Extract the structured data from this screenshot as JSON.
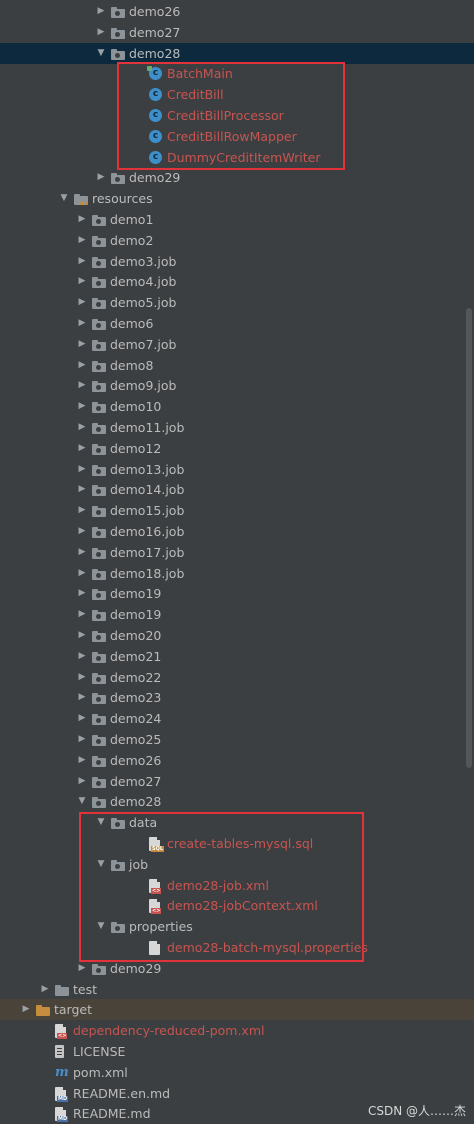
{
  "tree": [
    {
      "label": "demo26",
      "indent": 2,
      "arrow": "right",
      "icon": "folder",
      "style": "normal",
      "icon_name": "folder-icon"
    },
    {
      "label": "demo27",
      "indent": 2,
      "arrow": "right",
      "icon": "folder",
      "style": "normal",
      "icon_name": "folder-icon"
    },
    {
      "label": "demo28",
      "indent": 2,
      "arrow": "down",
      "icon": "folder",
      "style": "normal",
      "selected": true,
      "icon_name": "folder-icon"
    },
    {
      "label": "BatchMain",
      "indent": 3,
      "arrow": "",
      "icon": "class-main",
      "style": "file-mod",
      "icon_name": "class-main-icon"
    },
    {
      "label": "CreditBill",
      "indent": 3,
      "arrow": "",
      "icon": "class",
      "style": "file-mod",
      "icon_name": "class-icon"
    },
    {
      "label": "CreditBillProcessor",
      "indent": 3,
      "arrow": "",
      "icon": "class",
      "style": "file-mod",
      "icon_name": "class-icon"
    },
    {
      "label": "CreditBillRowMapper",
      "indent": 3,
      "arrow": "",
      "icon": "class",
      "style": "file-mod",
      "icon_name": "class-icon"
    },
    {
      "label": "DummyCreditItemWriter",
      "indent": 3,
      "arrow": "",
      "icon": "class",
      "style": "file-mod",
      "icon_name": "class-icon"
    },
    {
      "label": "demo29",
      "indent": 2,
      "arrow": "right",
      "icon": "folder",
      "style": "normal",
      "icon_name": "folder-icon"
    },
    {
      "label": "resources",
      "indent": 1,
      "arrow": "down",
      "icon": "res-folder",
      "style": "normal",
      "icon_name": "resources-folder-icon"
    },
    {
      "label": "demo1",
      "indent": 1.5,
      "arrow": "right",
      "icon": "folder",
      "style": "normal",
      "icon_name": "folder-icon"
    },
    {
      "label": "demo2",
      "indent": 1.5,
      "arrow": "right",
      "icon": "folder",
      "style": "normal",
      "icon_name": "folder-icon"
    },
    {
      "label": "demo3.job",
      "indent": 1.5,
      "arrow": "right",
      "icon": "folder",
      "style": "normal",
      "icon_name": "folder-icon"
    },
    {
      "label": "demo4.job",
      "indent": 1.5,
      "arrow": "right",
      "icon": "folder",
      "style": "normal",
      "icon_name": "folder-icon"
    },
    {
      "label": "demo5.job",
      "indent": 1.5,
      "arrow": "right",
      "icon": "folder",
      "style": "normal",
      "icon_name": "folder-icon"
    },
    {
      "label": "demo6",
      "indent": 1.5,
      "arrow": "right",
      "icon": "folder",
      "style": "normal",
      "icon_name": "folder-icon"
    },
    {
      "label": "demo7.job",
      "indent": 1.5,
      "arrow": "right",
      "icon": "folder",
      "style": "normal",
      "icon_name": "folder-icon"
    },
    {
      "label": "demo8",
      "indent": 1.5,
      "arrow": "right",
      "icon": "folder",
      "style": "normal",
      "icon_name": "folder-icon"
    },
    {
      "label": "demo9.job",
      "indent": 1.5,
      "arrow": "right",
      "icon": "folder",
      "style": "normal",
      "icon_name": "folder-icon"
    },
    {
      "label": "demo10",
      "indent": 1.5,
      "arrow": "right",
      "icon": "folder",
      "style": "normal",
      "icon_name": "folder-icon"
    },
    {
      "label": "demo11.job",
      "indent": 1.5,
      "arrow": "right",
      "icon": "folder",
      "style": "normal",
      "icon_name": "folder-icon"
    },
    {
      "label": "demo12",
      "indent": 1.5,
      "arrow": "right",
      "icon": "folder",
      "style": "normal",
      "icon_name": "folder-icon"
    },
    {
      "label": "demo13.job",
      "indent": 1.5,
      "arrow": "right",
      "icon": "folder",
      "style": "normal",
      "icon_name": "folder-icon"
    },
    {
      "label": "demo14.job",
      "indent": 1.5,
      "arrow": "right",
      "icon": "folder",
      "style": "normal",
      "icon_name": "folder-icon"
    },
    {
      "label": "demo15.job",
      "indent": 1.5,
      "arrow": "right",
      "icon": "folder",
      "style": "normal",
      "icon_name": "folder-icon"
    },
    {
      "label": "demo16.job",
      "indent": 1.5,
      "arrow": "right",
      "icon": "folder",
      "style": "normal",
      "icon_name": "folder-icon"
    },
    {
      "label": "demo17.job",
      "indent": 1.5,
      "arrow": "right",
      "icon": "folder",
      "style": "normal",
      "icon_name": "folder-icon"
    },
    {
      "label": "demo18.job",
      "indent": 1.5,
      "arrow": "right",
      "icon": "folder",
      "style": "normal",
      "icon_name": "folder-icon"
    },
    {
      "label": "demo19",
      "indent": 1.5,
      "arrow": "right",
      "icon": "folder",
      "style": "normal",
      "icon_name": "folder-icon"
    },
    {
      "label": "demo19",
      "indent": 1.5,
      "arrow": "right",
      "icon": "folder",
      "style": "normal",
      "icon_name": "folder-icon"
    },
    {
      "label": "demo20",
      "indent": 1.5,
      "arrow": "right",
      "icon": "folder",
      "style": "normal",
      "icon_name": "folder-icon"
    },
    {
      "label": "demo21",
      "indent": 1.5,
      "arrow": "right",
      "icon": "folder",
      "style": "normal",
      "icon_name": "folder-icon"
    },
    {
      "label": "demo22",
      "indent": 1.5,
      "arrow": "right",
      "icon": "folder",
      "style": "normal",
      "icon_name": "folder-icon"
    },
    {
      "label": "demo23",
      "indent": 1.5,
      "arrow": "right",
      "icon": "folder",
      "style": "normal",
      "icon_name": "folder-icon"
    },
    {
      "label": "demo24",
      "indent": 1.5,
      "arrow": "right",
      "icon": "folder",
      "style": "normal",
      "icon_name": "folder-icon"
    },
    {
      "label": "demo25",
      "indent": 1.5,
      "arrow": "right",
      "icon": "folder",
      "style": "normal",
      "icon_name": "folder-icon"
    },
    {
      "label": "demo26",
      "indent": 1.5,
      "arrow": "right",
      "icon": "folder",
      "style": "normal",
      "icon_name": "folder-icon"
    },
    {
      "label": "demo27",
      "indent": 1.5,
      "arrow": "right",
      "icon": "folder",
      "style": "normal",
      "icon_name": "folder-icon"
    },
    {
      "label": "demo28",
      "indent": 1.5,
      "arrow": "down",
      "icon": "folder",
      "style": "normal",
      "icon_name": "folder-icon"
    },
    {
      "label": "data",
      "indent": 2,
      "arrow": "down",
      "icon": "folder",
      "style": "normal",
      "icon_name": "folder-icon"
    },
    {
      "label": "create-tables-mysql.sql",
      "indent": 3,
      "arrow": "",
      "icon": "file-sql",
      "style": "file-mod",
      "icon_name": "sql-file-icon"
    },
    {
      "label": "job",
      "indent": 2,
      "arrow": "down",
      "icon": "folder",
      "style": "normal",
      "icon_name": "folder-icon"
    },
    {
      "label": "demo28-job.xml",
      "indent": 3,
      "arrow": "",
      "icon": "file-xml",
      "style": "file-mod",
      "icon_name": "xml-file-icon"
    },
    {
      "label": "demo28-jobContext.xml",
      "indent": 3,
      "arrow": "",
      "icon": "file-xml",
      "style": "file-mod",
      "icon_name": "xml-file-icon"
    },
    {
      "label": "properties",
      "indent": 2,
      "arrow": "down",
      "icon": "folder",
      "style": "normal",
      "icon_name": "folder-icon"
    },
    {
      "label": "demo28-batch-mysql.properties",
      "indent": 3,
      "arrow": "",
      "icon": "file-prop",
      "style": "file-mod",
      "icon_name": "properties-file-icon"
    },
    {
      "label": "demo29",
      "indent": 1.5,
      "arrow": "right",
      "icon": "folder",
      "style": "normal",
      "icon_name": "folder-icon"
    },
    {
      "label": "test",
      "indent": 0.5,
      "arrow": "right",
      "icon": "folder",
      "style": "normal",
      "icon_name": "folder-icon"
    },
    {
      "label": "target",
      "indent": 0,
      "arrow": "right",
      "icon": "folder-orange",
      "style": "normal",
      "target": true,
      "icon_name": "folder-icon"
    },
    {
      "label": "dependency-reduced-pom.xml",
      "indent": 0.5,
      "arrow": "",
      "icon": "file-xml",
      "style": "file-mod",
      "icon_name": "xml-file-icon"
    },
    {
      "label": "LICENSE",
      "indent": 0.5,
      "arrow": "",
      "icon": "license",
      "style": "normal",
      "icon_name": "license-file-icon"
    },
    {
      "label": "pom.xml",
      "indent": 0.5,
      "arrow": "",
      "icon": "maven",
      "style": "normal",
      "icon_name": "maven-file-icon"
    },
    {
      "label": "README.en.md",
      "indent": 0.5,
      "arrow": "",
      "icon": "file-md",
      "style": "normal",
      "icon_name": "markdown-file-icon"
    },
    {
      "label": "README.md",
      "indent": 0.5,
      "arrow": "",
      "icon": "file-md",
      "style": "normal",
      "icon_name": "markdown-file-icon"
    }
  ],
  "colors": {
    "background": "#3c3f41",
    "selected_row": "#0d293e",
    "modified_file_text": "#c75450",
    "normal_text": "#bbbbbb",
    "highlight_box": "#e2323a",
    "class_icon": "#3d8ec9",
    "orange_folder": "#c68d3e"
  },
  "watermark": "CSDN @人……杰"
}
